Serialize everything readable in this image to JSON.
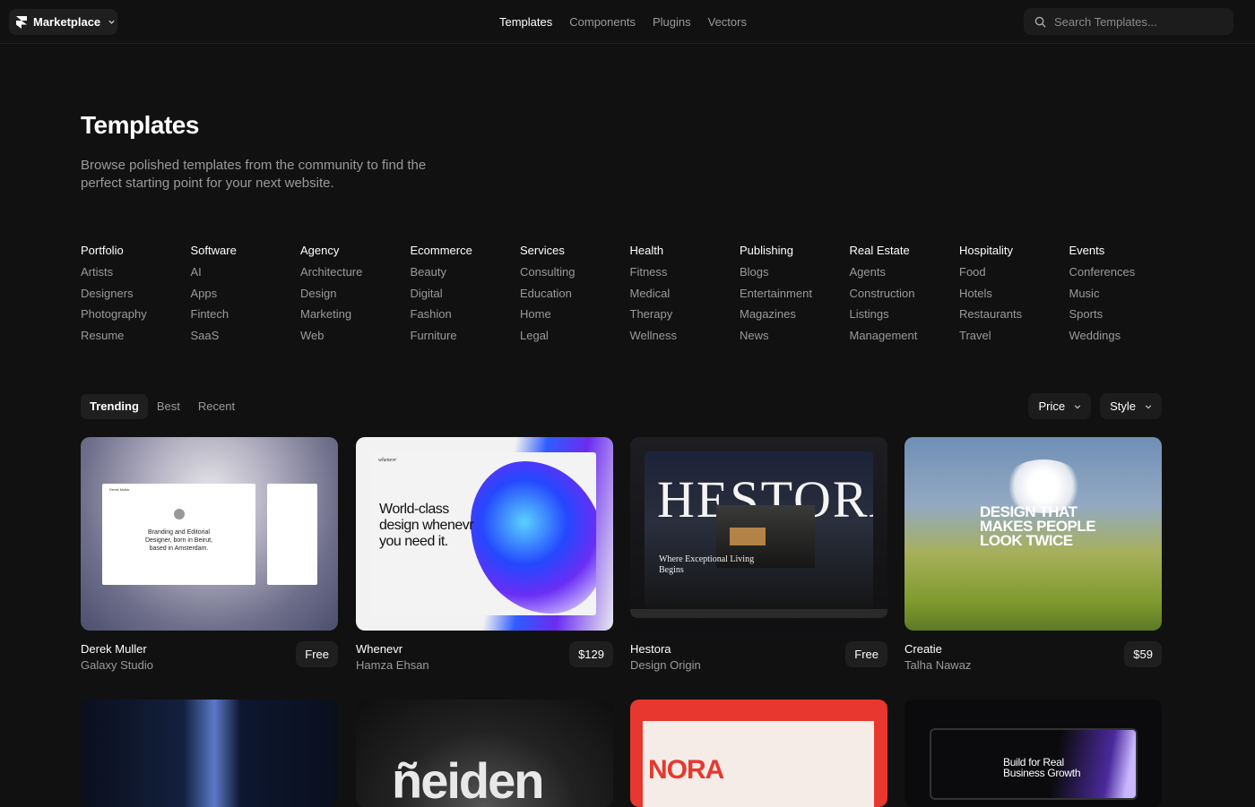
{
  "header": {
    "marketplace_label": "Marketplace",
    "nav": [
      {
        "label": "Templates",
        "active": true
      },
      {
        "label": "Components",
        "active": false
      },
      {
        "label": "Plugins",
        "active": false
      },
      {
        "label": "Vectors",
        "active": false
      }
    ],
    "search_placeholder": "Search Templates..."
  },
  "page": {
    "title": "Templates",
    "subtitle": "Browse polished templates from the community to find the perfect starting point for your next website."
  },
  "categories": [
    {
      "title": "Portfolio",
      "items": [
        "Artists",
        "Designers",
        "Photography",
        "Resume"
      ]
    },
    {
      "title": "Software",
      "items": [
        "AI",
        "Apps",
        "Fintech",
        "SaaS"
      ]
    },
    {
      "title": "Agency",
      "items": [
        "Architecture",
        "Design",
        "Marketing",
        "Web"
      ]
    },
    {
      "title": "Ecommerce",
      "items": [
        "Beauty",
        "Digital",
        "Fashion",
        "Furniture"
      ]
    },
    {
      "title": "Services",
      "items": [
        "Consulting",
        "Education",
        "Home",
        "Legal"
      ]
    },
    {
      "title": "Health",
      "items": [
        "Fitness",
        "Medical",
        "Therapy",
        "Wellness"
      ]
    },
    {
      "title": "Publishing",
      "items": [
        "Blogs",
        "Entertainment",
        "Magazines",
        "News"
      ]
    },
    {
      "title": "Real Estate",
      "items": [
        "Agents",
        "Construction",
        "Listings",
        "Management"
      ]
    },
    {
      "title": "Hospitality",
      "items": [
        "Food",
        "Hotels",
        "Restaurants",
        "Travel"
      ]
    },
    {
      "title": "Events",
      "items": [
        "Conferences",
        "Music",
        "Sports",
        "Weddings"
      ]
    }
  ],
  "sort_tabs": [
    {
      "label": "Trending",
      "active": true
    },
    {
      "label": "Best",
      "active": false
    },
    {
      "label": "Recent",
      "active": false
    }
  ],
  "filters": {
    "price_label": "Price",
    "style_label": "Style"
  },
  "templates": [
    {
      "name": "Derek Muller",
      "author": "Galaxy Studio",
      "price": "Free",
      "thumb_text": "Branding and Editorial Designer, born in Beirut, based in Amsterdam."
    },
    {
      "name": "Whenevr",
      "author": "Hamza Ehsan",
      "price": "$129",
      "thumb_text": "World-class design whenevr you need it."
    },
    {
      "name": "Hestora",
      "author": "Design Origin",
      "price": "Free",
      "thumb_text": "HESTORA",
      "thumb_sub": "Where Exceptional Living Begins"
    },
    {
      "name": "Creatie",
      "author": "Talha Nawaz",
      "price": "$59",
      "thumb_text": "DESIGN THAT MAKES PEOPLE LOOK TWICE"
    }
  ],
  "templates_row2": [
    {
      "thumb_text": ""
    },
    {
      "thumb_text": "ñeiden"
    },
    {
      "thumb_text": "NORA"
    },
    {
      "thumb_text": "Build for Real Business Growth"
    }
  ],
  "colors": {
    "background": "#111111",
    "surface": "#1f1f1f",
    "muted_text": "#9a9a9a",
    "text": "#ffffff"
  }
}
